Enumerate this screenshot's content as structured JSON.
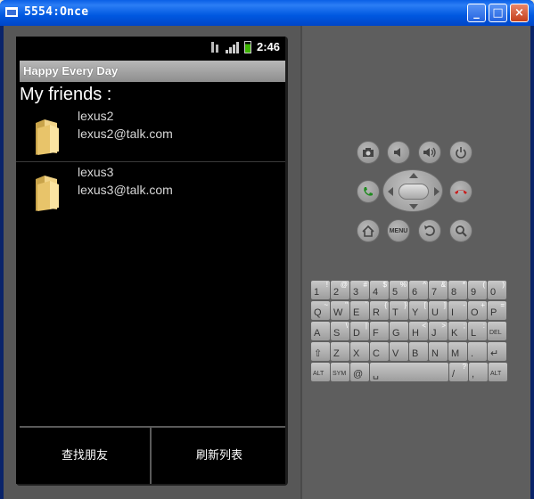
{
  "window": {
    "title": "5554:Once",
    "minimize_label": "_",
    "maximize_label": "□",
    "close_label": "×"
  },
  "status_bar": {
    "time": "2:46",
    "network": "3G"
  },
  "app": {
    "title": "Happy Every Day",
    "heading": "My friends :",
    "friends": [
      {
        "name": "lexus2",
        "email": "lexus2@talk.com"
      },
      {
        "name": "lexus3",
        "email": "lexus3@talk.com"
      }
    ],
    "buttons": {
      "find_friends": "查找朋友",
      "refresh_list": "刷新列表"
    }
  },
  "hardware": {
    "menu_label": "MENU"
  },
  "keyboard": {
    "row1": [
      [
        "1",
        "!"
      ],
      [
        "2",
        "@"
      ],
      [
        "3",
        "#"
      ],
      [
        "4",
        "$"
      ],
      [
        "5",
        "%"
      ],
      [
        "6",
        "^"
      ],
      [
        "7",
        "&"
      ],
      [
        "8",
        "*"
      ],
      [
        "9",
        "("
      ],
      [
        "0",
        ")"
      ]
    ],
    "row2": [
      [
        "Q",
        "~"
      ],
      [
        "W",
        "\""
      ],
      [
        "E",
        "`"
      ],
      [
        "R",
        "{"
      ],
      [
        "T",
        "}"
      ],
      [
        "Y",
        "["
      ],
      [
        "U",
        "]"
      ],
      [
        "I",
        "-"
      ],
      [
        "O",
        "+"
      ],
      [
        "P",
        "="
      ]
    ],
    "row3": [
      [
        "A",
        ""
      ],
      [
        "S",
        "\\"
      ],
      [
        "D",
        "|"
      ],
      [
        "F",
        ""
      ],
      [
        "G",
        ""
      ],
      [
        "H",
        "<"
      ],
      [
        "J",
        ">"
      ],
      [
        "K",
        ";"
      ],
      [
        "L",
        ":"
      ],
      [
        "DEL",
        ""
      ]
    ],
    "row4": [
      [
        "⇧",
        ""
      ],
      [
        "Z",
        ""
      ],
      [
        "X",
        ""
      ],
      [
        "C",
        ""
      ],
      [
        "V",
        ""
      ],
      [
        "B",
        ""
      ],
      [
        "N",
        ""
      ],
      [
        "M",
        ""
      ],
      [
        ".",
        ""
      ],
      [
        "↵",
        ""
      ]
    ],
    "row5": [
      [
        "ALT",
        ""
      ],
      [
        "SYM",
        ""
      ],
      [
        "@",
        ""
      ],
      [
        "␣",
        ""
      ],
      [
        "/",
        "?"
      ],
      [
        ",",
        ""
      ],
      [
        "ALT",
        ""
      ]
    ]
  },
  "colors": {
    "titlebar_blue": "#0058e0",
    "emulator_bg": "#575757",
    "screen_bg": "#000000",
    "app_titlebar": "#a0a0a0",
    "battery_green": "#3cb400"
  }
}
